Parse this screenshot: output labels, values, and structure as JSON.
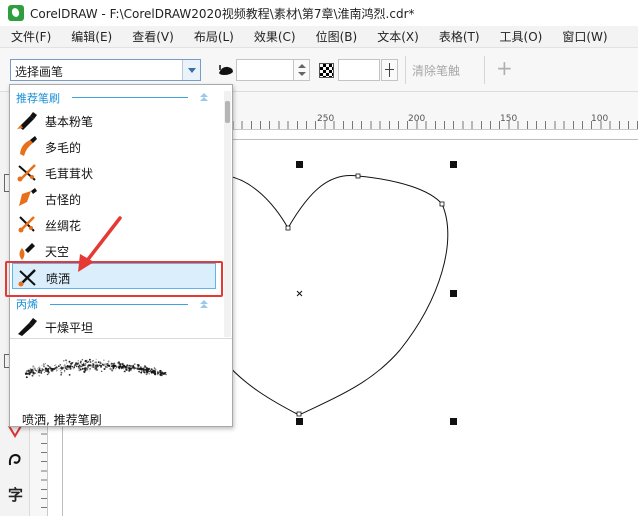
{
  "window": {
    "title": "CorelDRAW - F:\\CorelDRAW2020视频教程\\素材\\第7章\\淮南鸿烈.cdr*"
  },
  "menu": [
    {
      "label": "文件(F)"
    },
    {
      "label": "编辑(E)"
    },
    {
      "label": "查看(V)"
    },
    {
      "label": "布局(L)"
    },
    {
      "label": "效果(C)"
    },
    {
      "label": "位图(B)"
    },
    {
      "label": "文本(X)"
    },
    {
      "label": "表格(T)"
    },
    {
      "label": "工具(O)"
    },
    {
      "label": "窗口(W)"
    }
  ],
  "toolbar": {
    "brush_select_value": "选择画笔",
    "clear_stroke_label": "清除笔触",
    "add_label": "+"
  },
  "ruler": {
    "top_labels": [
      "250",
      "200",
      "150",
      "100"
    ]
  },
  "toolbox": {
    "text_tool_glyph": "字"
  },
  "brush_panel": {
    "groups": [
      {
        "title": "推荐笔刷",
        "items": [
          {
            "label": "基本粉笔",
            "selected": false
          },
          {
            "label": "多毛的",
            "selected": false
          },
          {
            "label": "毛茸茸状",
            "selected": false
          },
          {
            "label": "古怪的",
            "selected": false
          },
          {
            "label": "丝绸花",
            "selected": false
          },
          {
            "label": "天空",
            "selected": false
          },
          {
            "label": "喷洒",
            "selected": true
          }
        ]
      },
      {
        "title": "丙烯",
        "items": [
          {
            "label": "干燥平坦",
            "selected": false
          }
        ]
      }
    ],
    "preview_caption": "喷洒, 推荐笔刷"
  },
  "colors": {
    "accent": "#1a8fd8",
    "brush_orange": "#e8701a",
    "selection_fill": "#dbeefb",
    "annotation_red": "#e53935"
  }
}
